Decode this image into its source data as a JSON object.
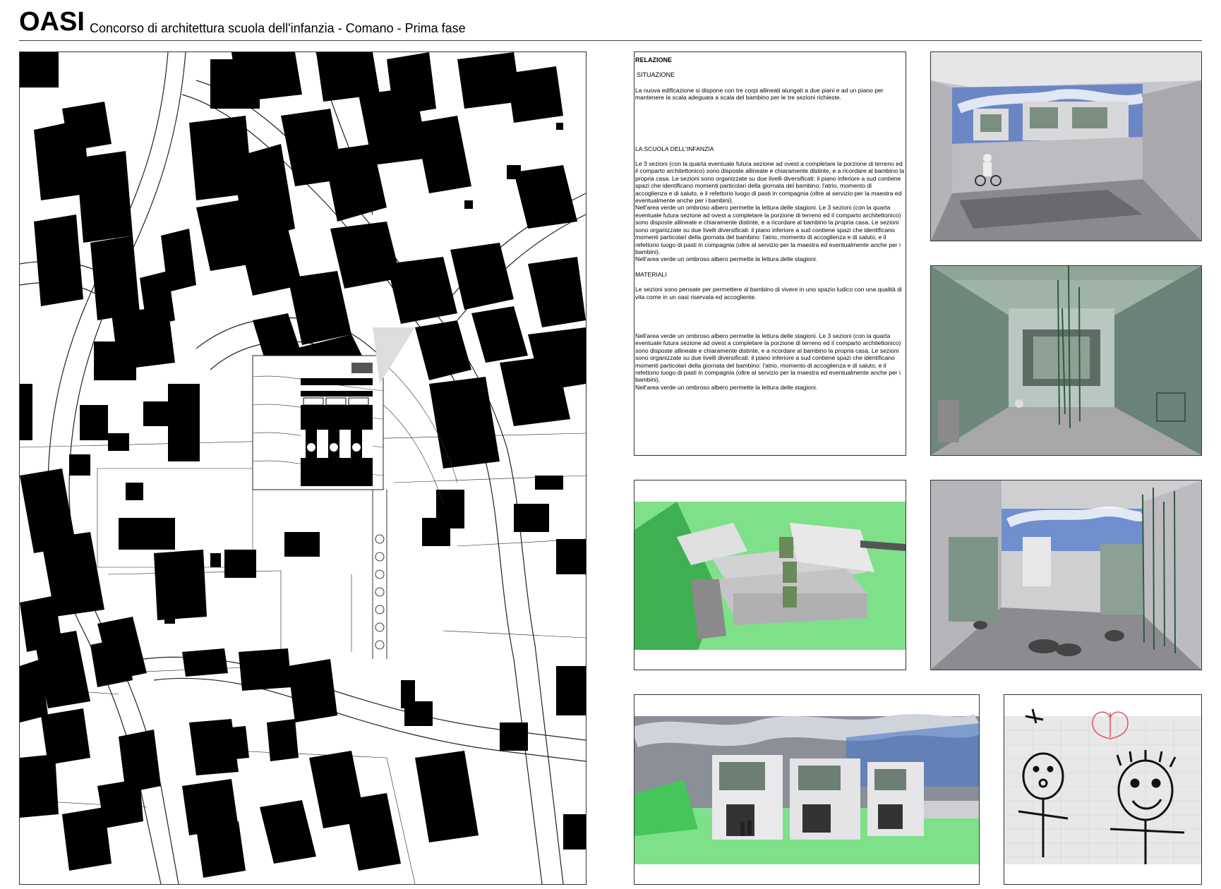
{
  "header": {
    "title": "OASI",
    "subtitle": "Concorso di architettura scuola dell'infanzia - Comano - Prima fase"
  },
  "relazione": {
    "title": "RELAZIONE",
    "situazione_heading": "SITUAZIONE",
    "situazione_text": "La nuova edificazione si dispone con tre corpi allineati alungati a due piani e ad un piano per mantenere la scala adeguata a scala del bambino per  le tre sezioni richieste.",
    "scuola_heading": "LA SCUOLA DELL'INFANZIA",
    "scuola_text_1": "Le 3 sezioni (con la quarta eventuale futura sezione ad ovest a completare la porzione di terreno ed il comparto architettonico) sono disposte allineate e chiaramente distinte, e a ricordare al bambino la propria casa. Le sezioni sono organizzate su due livelli diversificati: il piano inferiore a sud contiene spazi che identificano momenti particolari della giornata del bambino: l'atrio, momento di accoglienza e di saluto, e il refettorio luogo di pasti in compagnia (oltre al servizio per la maestra ed eventualmente anche per i bambini).",
    "scuola_text_2": "Nell'area verde un ombroso albero permette la lettura delle stagioni. Le 3 sezioni (con la quarta eventuale futura sezione ad ovest a completare  la porzione di terreno ed il comparto architettonico) sono disposte allineate e chiaramente distinte, e a ricordare al bambino la propria casa. Le sezioni sono organizzate su due livelli diversificati: il piano inferiore a sud contiene spazi che identificano momenti particolari della giornata del bambino: l'atrio, momento di accoglienza e di saluto, e il refettorio luogo di pasti in compagnia (oltre al servizio per la maestra ed eventualmente anche per i bambini).",
    "scuola_text_3": "Nell'area verde un ombroso albero permette la lettura delle stagioni.",
    "materiali_heading": "MATERIALI",
    "materiali_text": "Le sezioni sono pensate per permettere al bambino di vivere in uno spazio ludico con una qualità di vita come in un oasi riservata ed accogliente.",
    "extra_text_1": "Nell'area verde un ombroso albero permette la lettura delle stagioni. Le 3 sezioni (con la quarta eventuale futura sezione ad ovest a completare  la porzione di terreno ed il comparto architettonico) sono disposte allineate e chiaramente distinte, e a ricordare al bambino la propria casa. Le sezioni sono organizzate su due livelli diversificati: il piano inferiore a sud contiene spazi che identificano momenti particolari della giornata del bambino: l'atrio, momento di accoglienza e di saluto, e il refettorio luogo di pasti in compagnia (oltre al servizio per la maestra ed eventualmente anche per i bambini).",
    "extra_text_2": "Nell'area verde un ombroso albero permette la lettura delle stagioni."
  },
  "colors": {
    "lawn_green": "#7fe08a",
    "render_grey": "#c9c9cc",
    "glass_green": "#5f7a6e",
    "sky_blue": "#5a7fc0"
  }
}
